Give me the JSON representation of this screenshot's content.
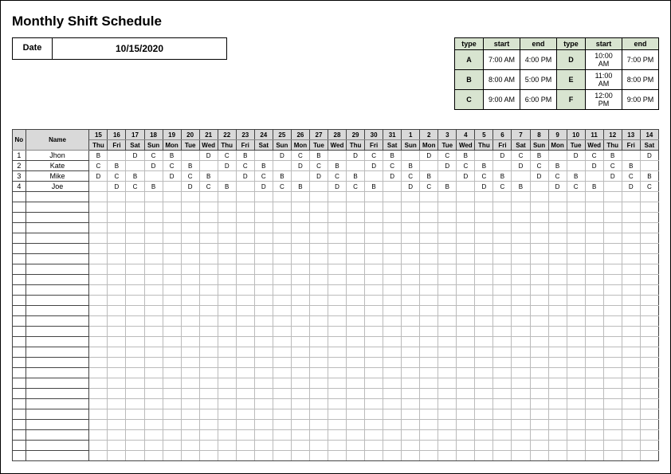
{
  "title": "Monthly Shift Schedule",
  "date_label": "Date",
  "date_value": "10/15/2020",
  "shift_types_header": {
    "type": "type",
    "start": "start",
    "end": "end"
  },
  "shift_types": [
    {
      "type": "A",
      "start": "7:00 AM",
      "end": "4:00 PM"
    },
    {
      "type": "B",
      "start": "8:00 AM",
      "end": "5:00 PM"
    },
    {
      "type": "C",
      "start": "9:00 AM",
      "end": "6:00 PM"
    },
    {
      "type": "D",
      "start": "10:00 AM",
      "end": "7:00 PM"
    },
    {
      "type": "E",
      "start": "11:00 AM",
      "end": "8:00 PM"
    },
    {
      "type": "F",
      "start": "12:00 PM",
      "end": "9:00 PM"
    }
  ],
  "schedule": {
    "header_no": "No",
    "header_name": "Name",
    "dates": [
      "15",
      "16",
      "17",
      "18",
      "19",
      "20",
      "21",
      "22",
      "23",
      "24",
      "25",
      "26",
      "27",
      "28",
      "29",
      "30",
      "31",
      "1",
      "2",
      "3",
      "4",
      "5",
      "6",
      "7",
      "8",
      "9",
      "10",
      "11",
      "12",
      "13",
      "14"
    ],
    "dows": [
      "Thu",
      "Fri",
      "Sat",
      "Sun",
      "Mon",
      "Tue",
      "Wed",
      "Thu",
      "Fri",
      "Sat",
      "Sun",
      "Mon",
      "Tue",
      "Wed",
      "Thu",
      "Fri",
      "Sat",
      "Sun",
      "Mon",
      "Tue",
      "Wed",
      "Thu",
      "Fri",
      "Sat",
      "Sun",
      "Mon",
      "Tue",
      "Wed",
      "Thu",
      "Fri",
      "Sat"
    ],
    "rows": [
      {
        "no": "1",
        "name": "Jhon",
        "shifts": [
          "B",
          "",
          "D",
          "C",
          "B",
          "",
          "D",
          "C",
          "B",
          "",
          "D",
          "C",
          "B",
          "",
          "D",
          "C",
          "B",
          "",
          "D",
          "C",
          "B",
          "",
          "D",
          "C",
          "B",
          "",
          "D",
          "C",
          "B",
          "",
          "D"
        ]
      },
      {
        "no": "2",
        "name": "Kate",
        "shifts": [
          "C",
          "B",
          "",
          "D",
          "C",
          "B",
          "",
          "D",
          "C",
          "B",
          "",
          "D",
          "C",
          "B",
          "",
          "D",
          "C",
          "B",
          "",
          "D",
          "C",
          "B",
          "",
          "D",
          "C",
          "B",
          "",
          "D",
          "C",
          "B",
          ""
        ]
      },
      {
        "no": "3",
        "name": "Mike",
        "shifts": [
          "D",
          "C",
          "B",
          "",
          "D",
          "C",
          "B",
          "",
          "D",
          "C",
          "B",
          "",
          "D",
          "C",
          "B",
          "",
          "D",
          "C",
          "B",
          "",
          "D",
          "C",
          "B",
          "",
          "D",
          "C",
          "B",
          "",
          "D",
          "C",
          "B"
        ]
      },
      {
        "no": "4",
        "name": "Joe",
        "shifts": [
          "",
          "D",
          "C",
          "B",
          "",
          "D",
          "C",
          "B",
          "",
          "D",
          "C",
          "B",
          "",
          "D",
          "C",
          "B",
          "",
          "D",
          "C",
          "B",
          "",
          "D",
          "C",
          "B",
          "",
          "D",
          "C",
          "B",
          "",
          "D",
          "C"
        ]
      }
    ],
    "empty_rows": 26
  }
}
